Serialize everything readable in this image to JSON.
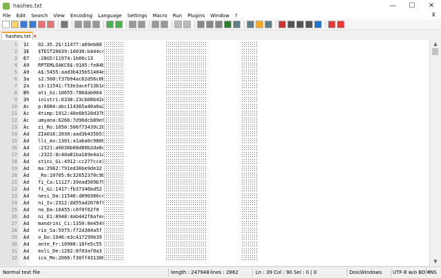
{
  "window": {
    "title": "hashes.txt",
    "minimize": "—",
    "maximize": "☐",
    "close": "✕"
  },
  "menu": [
    "File",
    "Edit",
    "Search",
    "View",
    "Encoding",
    "Language",
    "Settings",
    "Macro",
    "Run",
    "Plugins",
    "Window",
    "?"
  ],
  "menu_close": "X",
  "tab": {
    "label": "hashes.txt",
    "close": "✕"
  },
  "lines": [
    {
      "n": "1",
      "text": "1C   02.35.2$!11477:a69eb88"
    },
    {
      "n": "2",
      "text": "3E   $TEST20039:10030:b444c4"
    },
    {
      "n": "3",
      "text": "67   :28G5!11974:1b66c13"
    },
    {
      "n": "4",
      "text": "A9   RPTEMLOAKC6$:9105:fe84b"
    },
    {
      "n": "5",
      "text": "A9   A$:5455:aad3b435b51404ee"
    },
    {
      "n": "6",
      "text": "3a   s2:500:f37b94ac62d56c0b"
    },
    {
      "n": "7",
      "text": "2a   s3:11541:f53e3acef13b1ee"
    },
    {
      "n": "8",
      "text": "Bh   ati_Gi:10655:786dab064"
    },
    {
      "n": "9",
      "text": "3h   inistri:6338:23cb08b42e"
    },
    {
      "n": "10",
      "text": "Ac   p:8084:abc114365a40a0a2"
    },
    {
      "n": "11",
      "text": "Ac   4timp:1912:40e6b520d37b"
    },
    {
      "n": "12",
      "text": "Ac   umyana:6266:7d96dcb89ef1"
    },
    {
      "n": "13",
      "text": "Ac   zi_Ro:1050:506f73439c20"
    },
    {
      "n": "14",
      "text": "Ad   ZIA016:2030:aad3b435b51"
    },
    {
      "n": "15",
      "text": "Ad   lli_An:1301:a1aba0c9800"
    },
    {
      "n": "16",
      "text": "Ad   :2321:a6036b08d86b2da8c"
    },
    {
      "n": "17",
      "text": "Ad   :2322:0c40a81ba169e4a1a"
    },
    {
      "n": "18",
      "text": "Ad   stini_Gi:4912:cc277cce1b"
    },
    {
      "n": "19",
      "text": "Ad   ma:2962:791ed36be9de32"
    },
    {
      "n": "20",
      "text": "Ad   _Ro:10705:8c32652370c9b"
    },
    {
      "n": "21",
      "text": "Ad   fi_Ca:11127:39ead569b79"
    },
    {
      "n": "22",
      "text": "Ad   fi_Gi:1417:fb37346bd52"
    },
    {
      "n": "23",
      "text": "Ad   nesi_Da:11540:d090386c4"
    },
    {
      "n": "24",
      "text": "Ad   ni_Iv:2312:dd55ad2078ff"
    },
    {
      "n": "25",
      "text": "Ad   no_Da:10455:c0f0f62f0"
    },
    {
      "n": "26",
      "text": "Ad   ni_E1:8948:4ab442f8afea"
    },
    {
      "n": "27",
      "text": "Ad   mandrini_Ci:1350:8e454f"
    },
    {
      "n": "28",
      "text": "Ad   rio_Sa:5975:f72d384a5f"
    },
    {
      "n": "29",
      "text": "Ad   o_Do:1946:e3c417299b39"
    },
    {
      "n": "30",
      "text": "Ad   ante_Fr:10908:18fe5c55"
    },
    {
      "n": "31",
      "text": "Ad   eoli_De:1282:8f03af8a3"
    },
    {
      "n": "32",
      "text": "Ad   ico_Mo:2066:f30ff431300"
    }
  ],
  "status": {
    "filetype": "Normal text file",
    "length": "length : 247948",
    "lines": "lines : 2862",
    "position": "Ln : 39    Col : 90    Sel : 0 | 0",
    "eol": "Dos\\Windows",
    "encoding": "UTF-8 w/o BOM",
    "mode": "INS"
  },
  "toolbar_icons": [
    "new-file",
    "open-file",
    "save-file",
    "save-all",
    "close-file",
    "close-all",
    "print",
    "cut",
    "copy",
    "paste",
    "undo",
    "redo",
    "find",
    "replace",
    "zoom-in",
    "zoom-out",
    "sync-v",
    "sync-h",
    "word-wrap",
    "show-all",
    "indent-guide",
    "user-lang",
    "doc-map",
    "func-list",
    "folder-workspace",
    "monitor",
    "record-macro",
    "stop-macro",
    "play-macro",
    "run-macro-multi",
    "save-macro",
    "spellcheck",
    "abc-check"
  ]
}
